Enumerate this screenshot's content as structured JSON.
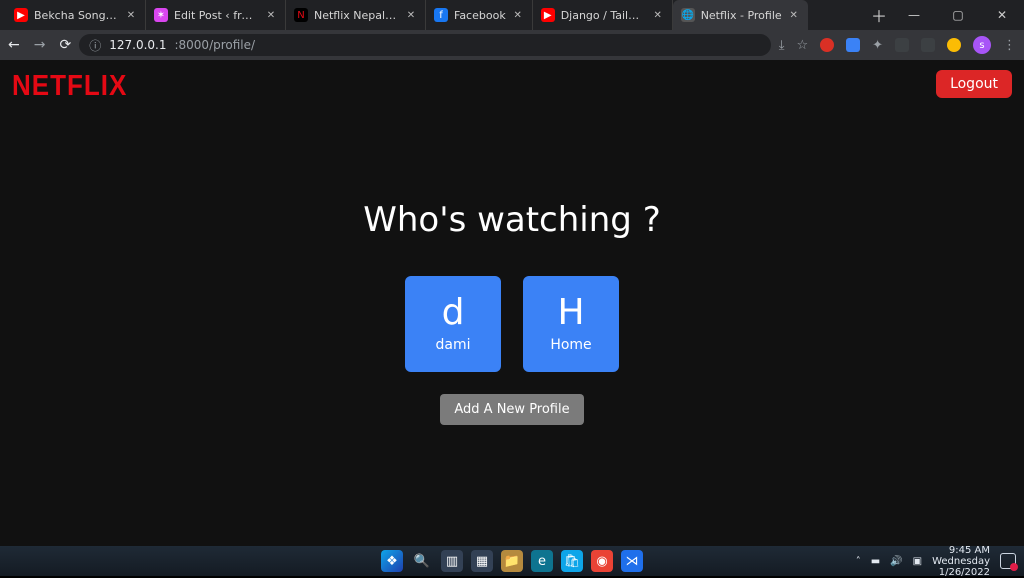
{
  "browser": {
    "tabs": [
      {
        "title": "Bekcha Songs Collecti",
        "favicon_bg": "#ff0000",
        "favicon_glyph": "▶",
        "active": false
      },
      {
        "title": "Edit Post ‹ free project",
        "favicon_bg": "#d946ef",
        "favicon_glyph": "✶",
        "active": false
      },
      {
        "title": "Netflix Nepal - Watch",
        "favicon_bg": "#000000",
        "favicon_glyph": "N",
        "favicon_color": "#e50914",
        "active": false
      },
      {
        "title": "Facebook",
        "favicon_bg": "#1877f2",
        "favicon_glyph": "f",
        "active": false
      },
      {
        "title": "Django / Tailwind Tut",
        "favicon_bg": "#ff0000",
        "favicon_glyph": "▶",
        "active": false
      },
      {
        "title": "Netflix - Profile",
        "favicon_bg": "#555555",
        "favicon_glyph": "🌐",
        "active": true
      }
    ],
    "address": {
      "info_icon": "ⓘ",
      "host": "127.0.0.1",
      "rest": ":8000/profile/"
    },
    "avatar_letter": "s"
  },
  "page": {
    "brand": "NETFLIX",
    "logout_label": "Logout",
    "heading": "Who's watching ?",
    "profiles": [
      {
        "initial": "d",
        "name": "dami"
      },
      {
        "initial": "H",
        "name": "Home"
      }
    ],
    "add_label": "Add A New Profile"
  },
  "taskbar": {
    "time": "9:45 AM",
    "day": "Wednesday",
    "date": "1/26/2022"
  }
}
